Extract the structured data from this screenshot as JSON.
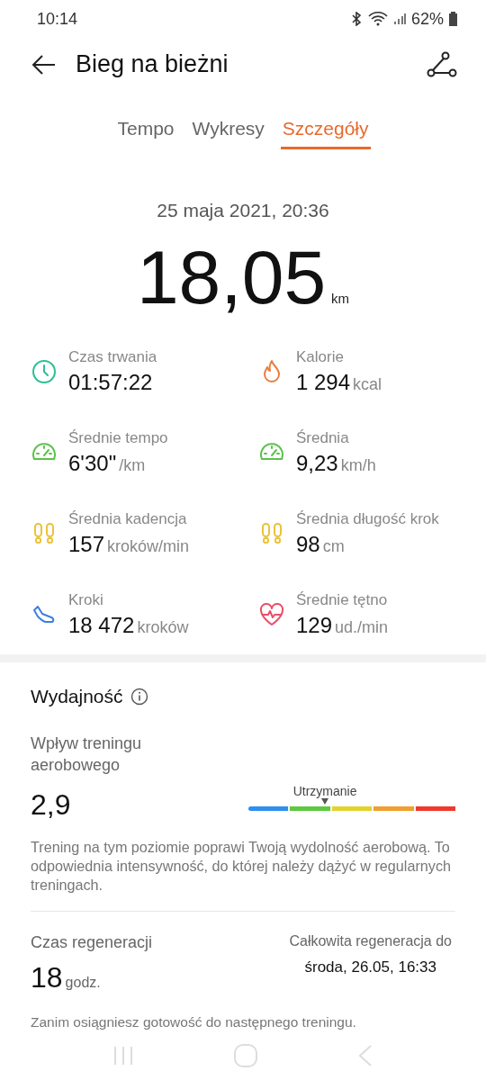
{
  "status_bar": {
    "time": "10:14",
    "battery": "62%"
  },
  "header": {
    "title": "Bieg na bieżni"
  },
  "tabs": [
    {
      "label": "Tempo",
      "selected": false
    },
    {
      "label": "Wykresy",
      "selected": false
    },
    {
      "label": "Szczegóły",
      "selected": true
    }
  ],
  "summary": {
    "date": "25 maja 2021, 20:36",
    "distance": "18,05",
    "unit": "km"
  },
  "metrics": [
    {
      "kind": "clock",
      "color": "#2bbf95",
      "label": "Czas trwania",
      "value": "01:57:22"
    },
    {
      "kind": "flame",
      "color": "#e8803e",
      "label": "Kalorie",
      "value": "1 294",
      "unit": "kcal"
    },
    {
      "kind": "gauge",
      "color": "#5ac24a",
      "label": "Średnie tempo",
      "value": "6'30\"",
      "unit": "/km"
    },
    {
      "kind": "gauge",
      "color": "#5ac24a",
      "label": "Średnia",
      "value": "9,23",
      "unit": "km/h"
    },
    {
      "kind": "feet",
      "color": "#ebc23a",
      "label": "Średnia kadencja",
      "value": "157",
      "unit": "kroków/min"
    },
    {
      "kind": "feet",
      "color": "#ebc23a",
      "label": "Średnia długość krok",
      "value": "98",
      "unit": "cm"
    },
    {
      "kind": "shoe",
      "color": "#3f7fe0",
      "label": "Kroki",
      "value": "18 472",
      "unit": "kroków"
    },
    {
      "kind": "heart",
      "color": "#e8506a",
      "label": "Średnie tętno",
      "value": "129",
      "unit": "ud./min"
    }
  ],
  "performance": {
    "title": "Wydajność",
    "aerobic": {
      "label": "Wpływ treningu aerobowego",
      "value": "2,9",
      "scale_label": "Utrzymanie",
      "level": 0.37,
      "segments": [
        {
          "color": "#2f8ff0"
        },
        {
          "color": "#5ec940"
        },
        {
          "color": "#e3d12e"
        },
        {
          "color": "#f0a030"
        },
        {
          "color": "#ee3a2c"
        }
      ],
      "description": "Trening na tym poziomie poprawi Twoją wydolność aerobową. To odpowiednia intensywność, do której należy dążyć w regularnych treningach."
    },
    "recovery": {
      "label": "Czas regeneracji",
      "value": "18",
      "unit": "godz.",
      "full_label": "Całkowita regeneracja do",
      "full_value": "środa, 26.05, 16:33",
      "note": "Zanim osiągniesz gotowość do następnego treningu."
    }
  }
}
